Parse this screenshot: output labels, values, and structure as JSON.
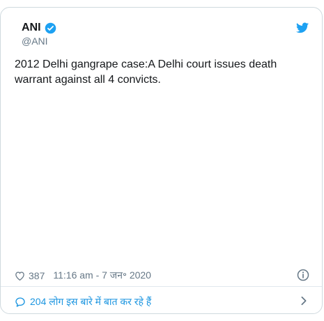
{
  "tweet": {
    "author_name": "ANI",
    "author_handle": "@ANI",
    "text": "2012 Delhi gangrape case:A Delhi court issues death warrant against all 4 convicts.",
    "like_count": "387",
    "timestamp": "11:16 am - 7 जन॰ 2020",
    "conversation_text": "204 लोग इस बारे में बात कर रहे हैं"
  },
  "icons": {
    "verified": "verified-badge-icon",
    "brand": "twitter-bird-icon",
    "like": "heart-icon",
    "info": "info-icon",
    "conversation": "speech-bubble-icon",
    "chevron": "chevron-right-icon"
  },
  "colors": {
    "brand_blue": "#1da1f2",
    "link_blue": "#1b95e0",
    "muted_text": "#657786",
    "border": "#cfd9de"
  }
}
